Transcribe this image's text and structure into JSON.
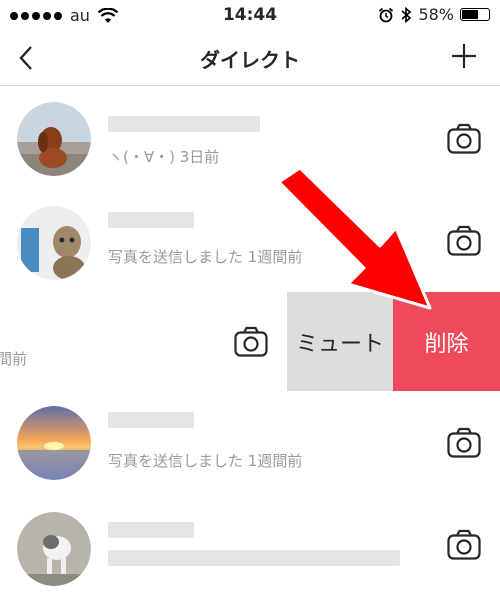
{
  "status_bar": {
    "carrier": "au",
    "time": "14:44",
    "battery_percent": "58%",
    "battery_level": 0.58
  },
  "nav": {
    "back_icon": "chevron-left-icon",
    "title": "ダイレクト",
    "add_icon": "plus-icon"
  },
  "threads": [
    {
      "subtitle": "ヽ(・∀・) 3日前",
      "action_icon": "camera-icon"
    },
    {
      "subtitle": "写真を送信しました 1週間前",
      "action_icon": "camera-icon"
    },
    {
      "subtitle": "週間前",
      "action_icon": "camera-icon"
    },
    {
      "subtitle": "写真を送信しました 1週間前",
      "action_icon": "camera-icon"
    },
    {
      "subtitle": "",
      "action_icon": "camera-icon"
    }
  ],
  "swipe_actions": {
    "mute_label": "ミュート",
    "delete_label": "削除",
    "mute_color": "#dddddd",
    "delete_color": "#ef4a5c"
  },
  "annotation": {
    "arrow_color": "#ff0000"
  }
}
